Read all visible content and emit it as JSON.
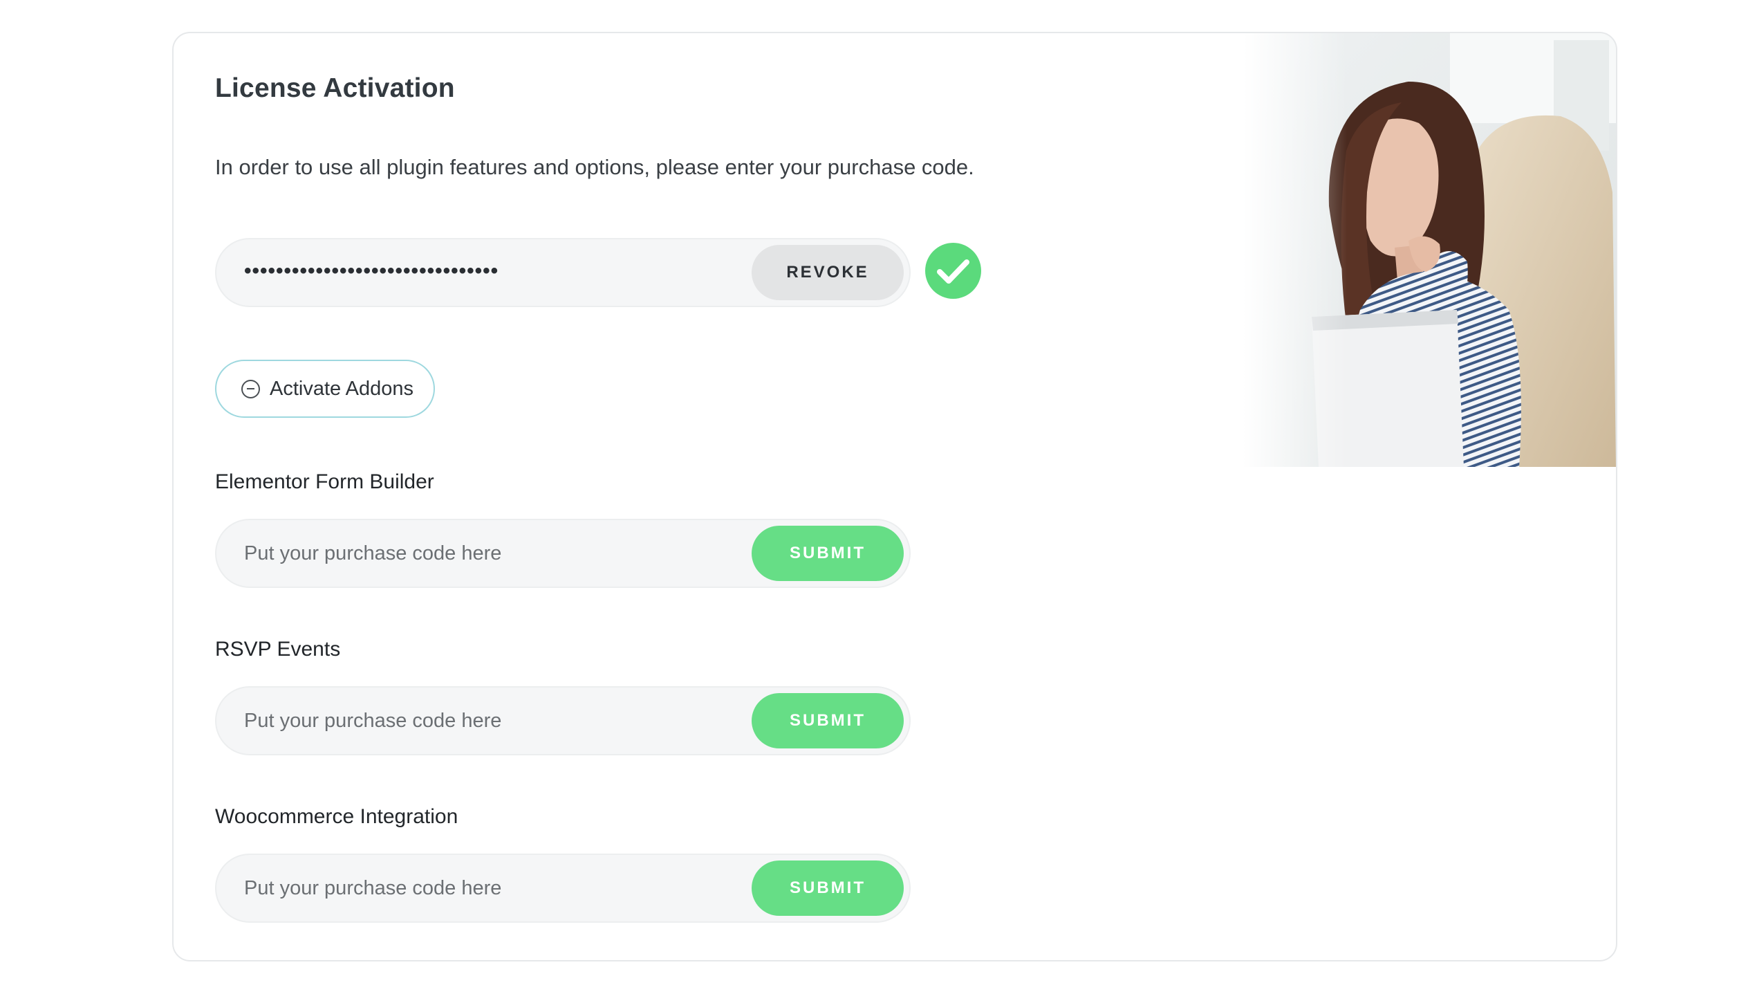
{
  "card": {
    "title": "License Activation",
    "intro": "In order to use all plugin features and options, please enter your purchase code."
  },
  "license": {
    "masked_code": "••••••••••••••••••••••••••••••••",
    "revoke_label": "REVOKE",
    "status": "verified",
    "status_icon": "check-circle-icon"
  },
  "addons_toggle": {
    "label": "Activate Addons",
    "icon": "minus-circle-icon"
  },
  "addons": [
    {
      "name": "Elementor Form Builder",
      "placeholder": "Put your purchase code here",
      "button": "SUBMIT"
    },
    {
      "name": "RSVP Events",
      "placeholder": "Put your purchase code here",
      "button": "SUBMIT"
    },
    {
      "name": "Woocommerce Integration",
      "placeholder": "Put your purchase code here",
      "button": "SUBMIT"
    }
  ],
  "colors": {
    "submit_green": "#66de86",
    "check_green": "#5bda7c",
    "revoke_gray": "#e3e4e5",
    "addons_border": "#9ed8df"
  }
}
